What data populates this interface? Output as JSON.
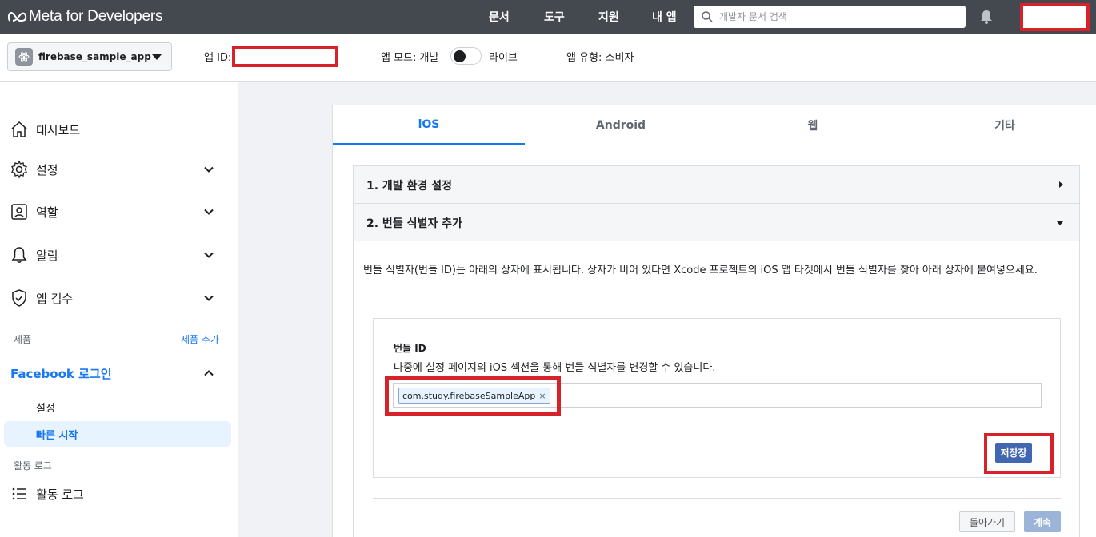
{
  "header": {
    "brand": "Meta for Developers",
    "nav": [
      "문서",
      "도구",
      "지원",
      "내 앱"
    ],
    "search_placeholder": "개발자 문서 검색"
  },
  "appbar": {
    "app_name": "firebase_sample_app",
    "app_id_label": "앱 ID:",
    "mode_label": "앱 모드:",
    "mode_dev": "개발",
    "mode_live": "라이브",
    "type_label": "앱 유형:",
    "type_value": "소비자"
  },
  "sidebar": {
    "items": [
      {
        "label": "대시보드"
      },
      {
        "label": "설정"
      },
      {
        "label": "역할"
      },
      {
        "label": "알림"
      },
      {
        "label": "앱 검수"
      }
    ],
    "products_label": "제품",
    "add_product": "제품 추가",
    "fb_login": "Facebook 로그인",
    "sub_settings": "설정",
    "sub_quickstart": "빠른 시작",
    "activity_section": "활동 로그",
    "activity_item": "활동 로그"
  },
  "tabs": [
    "iOS",
    "Android",
    "웹",
    "기타"
  ],
  "steps": {
    "step1": "1. 개발 환경 설정",
    "step2": "2. 번들 식별자 추가"
  },
  "bundle": {
    "description": "번들 식별자(번들 ID)는 아래의 상자에 표시됩니다. 상자가 비어 있다면 Xcode 프로젝트의 iOS 앱 타겟에서 번들 식별자를 찾아 아래 상자에 붙여넣으세요.",
    "title": "번들 ID",
    "help": "나중에 설정 페이지의 iOS 섹션을 통해 번들 식별자를 변경할 수 있습니다.",
    "token": "com.study.firebaseSampleApp",
    "token_remove": "×",
    "save": "저장장"
  },
  "footer": {
    "back": "돌아가기",
    "continue": "계속"
  },
  "colors": {
    "topbar": "#444950",
    "accent": "#1877f2",
    "highlight": "#d8222a",
    "save_button": "#4267b2"
  }
}
